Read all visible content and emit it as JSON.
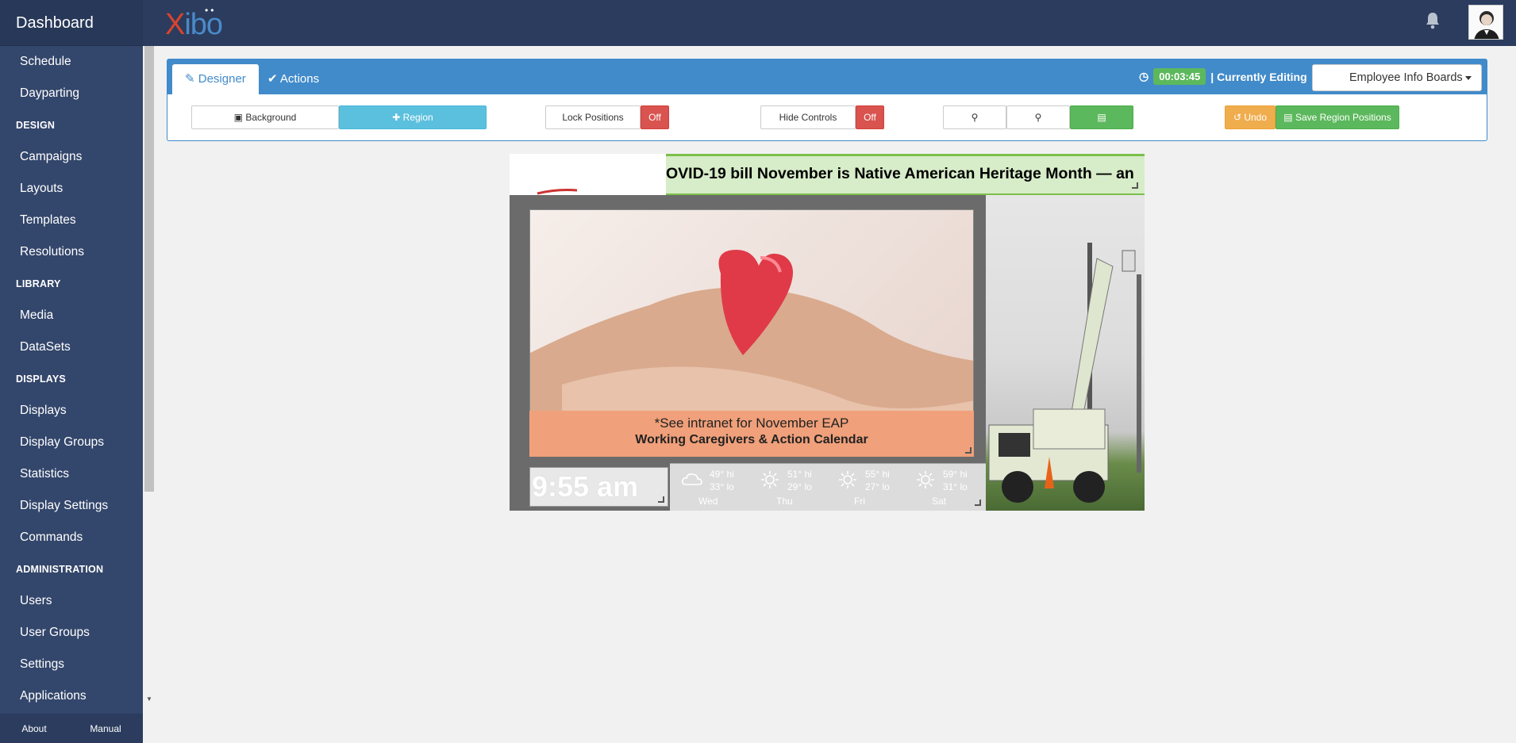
{
  "sidebar": {
    "title": "Dashboard",
    "items": [
      {
        "type": "item",
        "label": "Schedule"
      },
      {
        "type": "item",
        "label": "Dayparting"
      },
      {
        "type": "head",
        "label": "DESIGN"
      },
      {
        "type": "item",
        "label": "Campaigns"
      },
      {
        "type": "item",
        "label": "Layouts"
      },
      {
        "type": "item",
        "label": "Templates"
      },
      {
        "type": "item",
        "label": "Resolutions"
      },
      {
        "type": "head",
        "label": "LIBRARY"
      },
      {
        "type": "item",
        "label": "Media"
      },
      {
        "type": "item",
        "label": "DataSets"
      },
      {
        "type": "head",
        "label": "DISPLAYS"
      },
      {
        "type": "item",
        "label": "Displays"
      },
      {
        "type": "item",
        "label": "Display Groups"
      },
      {
        "type": "item",
        "label": "Statistics"
      },
      {
        "type": "item",
        "label": "Display Settings"
      },
      {
        "type": "item",
        "label": "Commands"
      },
      {
        "type": "head",
        "label": "ADMINISTRATION"
      },
      {
        "type": "item",
        "label": "Users"
      },
      {
        "type": "item",
        "label": "User Groups"
      },
      {
        "type": "item",
        "label": "Settings"
      },
      {
        "type": "item",
        "label": "Applications"
      }
    ],
    "footer": {
      "about": "About",
      "manual": "Manual"
    }
  },
  "header": {
    "logo_x": "X",
    "logo_rest": "ibo",
    "bell_icon": "bell-icon",
    "avatar_icon": "user-avatar"
  },
  "designer": {
    "tabs": {
      "designer": "Designer",
      "actions": "Actions"
    },
    "timer": "00:03:45",
    "currently_editing": "| Currently Editing",
    "layout_name": "Employee Info Boards",
    "toolbar": {
      "background": "Background",
      "region": "Region",
      "lock_positions": "Lock Positions",
      "lock_state": "Off",
      "hide_controls": "Hide Controls",
      "hide_state": "Off",
      "undo": "Undo",
      "save_positions": "Save Region Positions"
    }
  },
  "preview": {
    "ticker": "OVID-19 bill  November is Native American Heritage Month — an",
    "caption_line1": "*See intranet for November EAP",
    "caption_line2": "Working Caregivers & Action Calendar",
    "clock": "9:55 am",
    "weather": [
      {
        "day": "Wed",
        "hi": "49° hi",
        "lo": "33° lo",
        "icon": "cloud-icon"
      },
      {
        "day": "Thu",
        "hi": "51° hi",
        "lo": "29° lo",
        "icon": "sun-icon"
      },
      {
        "day": "Fri",
        "hi": "55° hi",
        "lo": "27° lo",
        "icon": "sun-icon"
      },
      {
        "day": "Sat",
        "hi": "59° hi",
        "lo": "31° lo",
        "icon": "sun-icon"
      }
    ]
  },
  "colors": {
    "sidebar": "#33466b",
    "topbar": "#2b3c5e",
    "panel": "#428bca",
    "success": "#5cb85c",
    "danger": "#d9534f",
    "warning": "#f0ad4e",
    "info": "#5bc0de"
  }
}
